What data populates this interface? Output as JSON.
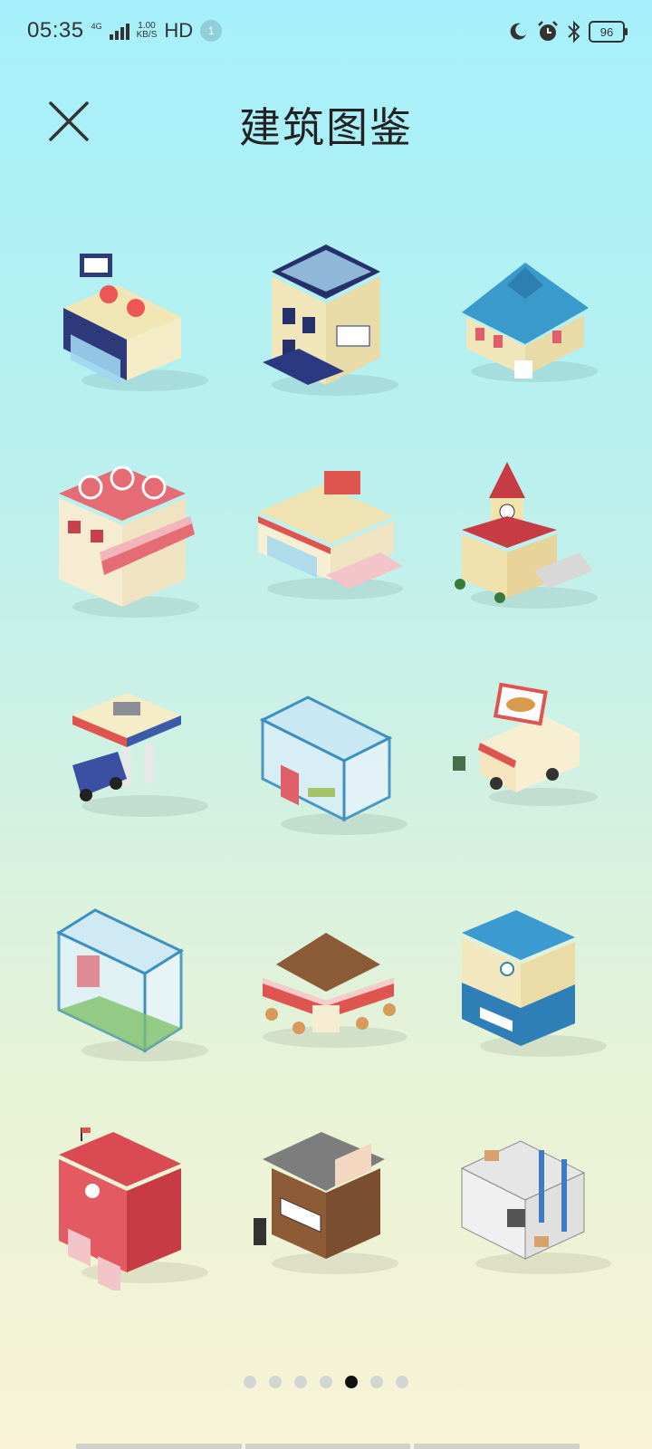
{
  "status_bar": {
    "time": "05:35",
    "network": "4G",
    "speed_value": "1.00",
    "speed_unit": "KB/S",
    "hd": "HD",
    "notification_count": "1",
    "battery": "96",
    "icons": [
      "moon-icon",
      "alarm-icon",
      "bluetooth-icon",
      "battery-icon"
    ]
  },
  "header": {
    "title": "建筑图鉴",
    "close_icon": "close-icon"
  },
  "buildings": [
    {
      "icon": "rooftop-cafe-icon"
    },
    {
      "icon": "post-office-icon"
    },
    {
      "icon": "blue-house-icon"
    },
    {
      "icon": "red-cafe-icon"
    },
    {
      "icon": "fast-food-icon"
    },
    {
      "icon": "clock-tower-icon"
    },
    {
      "icon": "gas-station-icon"
    },
    {
      "icon": "greenhouse-icon"
    },
    {
      "icon": "food-truck-icon"
    },
    {
      "icon": "glass-building-icon"
    },
    {
      "icon": "restaurant-icon"
    },
    {
      "icon": "police-station-icon"
    },
    {
      "icon": "fire-station-icon"
    },
    {
      "icon": "ramen-shop-icon"
    },
    {
      "icon": "warehouse-icon"
    }
  ],
  "pager": {
    "total": 7,
    "active_index": 4
  },
  "colors": {
    "bg_top": "#a6f0fb",
    "bg_bottom": "#f8f3d6",
    "dot_inactive": "#d2d6d3",
    "dot_active": "#111111"
  }
}
